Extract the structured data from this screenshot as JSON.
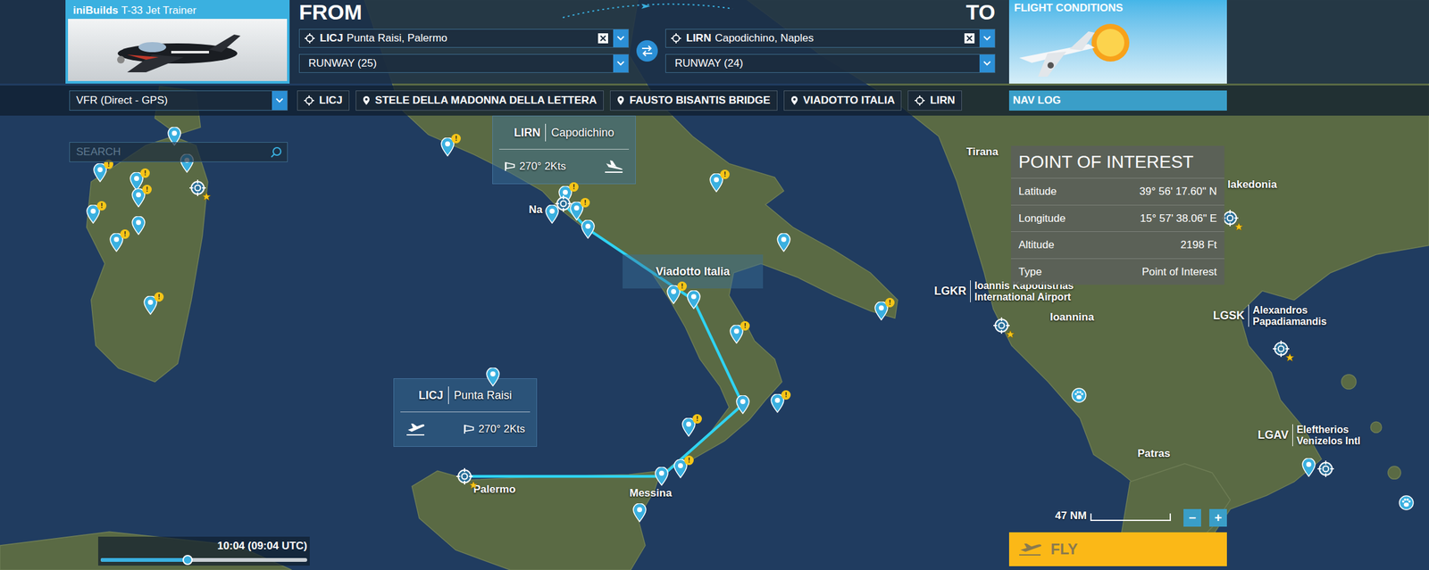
{
  "aircraft": {
    "maker": "iniBuilds",
    "model": "T-33 Jet Trainer",
    "selected": true
  },
  "from": {
    "label": "FROM",
    "icao": "LICJ",
    "name": "Punta Raisi, Palermo",
    "runway": "RUNWAY (25)"
  },
  "to": {
    "label": "TO",
    "icao": "LIRN",
    "name": "Capodichino, Naples",
    "runway": "RUNWAY (24)"
  },
  "flight_conditions": {
    "title": "FLIGHT CONDITIONS"
  },
  "flight_type": "VFR (Direct - GPS)",
  "waypoints": [
    {
      "kind": "airport",
      "label": "LICJ"
    },
    {
      "kind": "poi",
      "label": "STELE DELLA MADONNA DELLA LETTERA"
    },
    {
      "kind": "poi",
      "label": "FAUSTO BISANTIS BRIDGE"
    },
    {
      "kind": "poi",
      "label": "VIADOTTO ITALIA"
    },
    {
      "kind": "airport",
      "label": "LIRN"
    }
  ],
  "nav_log": "NAV LOG",
  "search": {
    "placeholder": "SEARCH"
  },
  "poi_panel": {
    "title": "POINT OF INTEREST",
    "rows": [
      {
        "label": "Latitude",
        "value": "39° 56' 17.60\" N"
      },
      {
        "label": "Longitude",
        "value": "15° 57' 38.06\" E"
      },
      {
        "label": "Altitude",
        "value": "2198 Ft"
      },
      {
        "label": "Type",
        "value": "Point of Interest"
      }
    ]
  },
  "map": {
    "airport_cards": [
      {
        "icao": "LIRN",
        "name": "Capodichino",
        "wind": "270° 2Kts",
        "role": "arrival"
      },
      {
        "icao": "LICJ",
        "name": "Punta Raisi",
        "wind": "270° 2Kts",
        "role": "departure"
      }
    ],
    "highlight_label": "Viadotto Italia",
    "labels": [
      {
        "text": "Tirana"
      },
      {
        "text": "Ioannina"
      },
      {
        "text": "Patras"
      },
      {
        "text": "lakedonia"
      },
      {
        "text": "Na"
      },
      {
        "text": "Messina"
      },
      {
        "text": "Palermo"
      }
    ],
    "airport_labels": [
      {
        "icao": "LGKR",
        "name_lines": [
          "Ioannis Kapodistrias",
          "International Airport"
        ]
      },
      {
        "icao": "LGSK",
        "name_lines": [
          "Alexandros",
          "Papadiamandis"
        ]
      },
      {
        "icao": "LGAV",
        "name_lines": [
          "Eleftherios",
          "Venizelos Intl"
        ]
      }
    ],
    "alert_glyph": "!",
    "pins": [
      {
        "kind": "poi",
        "alert": false,
        "featured": false
      },
      {
        "kind": "poi",
        "alert": true,
        "featured": false
      },
      {
        "kind": "poi",
        "alert": true,
        "featured": false
      },
      {
        "kind": "poi",
        "alert": true,
        "featured": false
      },
      {
        "kind": "poi",
        "alert": true,
        "featured": false
      },
      {
        "kind": "poi",
        "alert": true,
        "featured": false
      },
      {
        "kind": "poi",
        "alert": false,
        "featured": false
      },
      {
        "kind": "poi",
        "alert": true,
        "featured": false
      },
      {
        "kind": "poi",
        "alert": false,
        "featured": false
      },
      {
        "kind": "airport",
        "alert": false,
        "featured": true
      },
      {
        "kind": "poi",
        "alert": true,
        "featured": false
      },
      {
        "kind": "poi",
        "alert": true,
        "featured": false
      },
      {
        "kind": "airport",
        "alert": false,
        "featured": false
      },
      {
        "kind": "poi",
        "alert": true,
        "featured": false
      },
      {
        "kind": "poi",
        "alert": false,
        "featured": false
      },
      {
        "kind": "poi",
        "alert": false,
        "featured": false
      },
      {
        "kind": "poi",
        "alert": true,
        "featured": false
      },
      {
        "kind": "poi",
        "alert": false,
        "featured": false
      },
      {
        "kind": "poi",
        "alert": true,
        "featured": false
      },
      {
        "kind": "poi",
        "alert": false,
        "featured": false
      },
      {
        "kind": "poi",
        "alert": true,
        "featured": false
      },
      {
        "kind": "poi",
        "alert": false,
        "featured": false
      },
      {
        "kind": "poi",
        "alert": true,
        "featured": false
      },
      {
        "kind": "poi",
        "alert": true,
        "featured": false
      },
      {
        "kind": "poi",
        "alert": true,
        "featured": false
      },
      {
        "kind": "poi",
        "alert": true,
        "featured": false
      },
      {
        "kind": "poi",
        "alert": false,
        "featured": false
      },
      {
        "kind": "poi",
        "alert": false,
        "featured": false
      },
      {
        "kind": "poi",
        "alert": false,
        "featured": false
      },
      {
        "kind": "airport",
        "alert": false,
        "featured": true
      },
      {
        "kind": "airport",
        "alert": false,
        "featured": true
      },
      {
        "kind": "airport",
        "alert": false,
        "featured": true
      },
      {
        "kind": "airport",
        "alert": false,
        "featured": true
      },
      {
        "kind": "wildlife",
        "alert": false,
        "featured": false
      },
      {
        "kind": "poi",
        "alert": false,
        "featured": false
      },
      {
        "kind": "airport",
        "alert": false,
        "featured": false
      },
      {
        "kind": "wildlife",
        "alert": false,
        "featured": false
      }
    ]
  },
  "time": {
    "reading": "10:04 (09:04 UTC)",
    "level": 0.42
  },
  "scale": {
    "reading": "47 NM"
  },
  "zoom": {
    "out": "−",
    "in": "+"
  },
  "fly_button": {
    "label": "FLY",
    "disabled": true
  }
}
